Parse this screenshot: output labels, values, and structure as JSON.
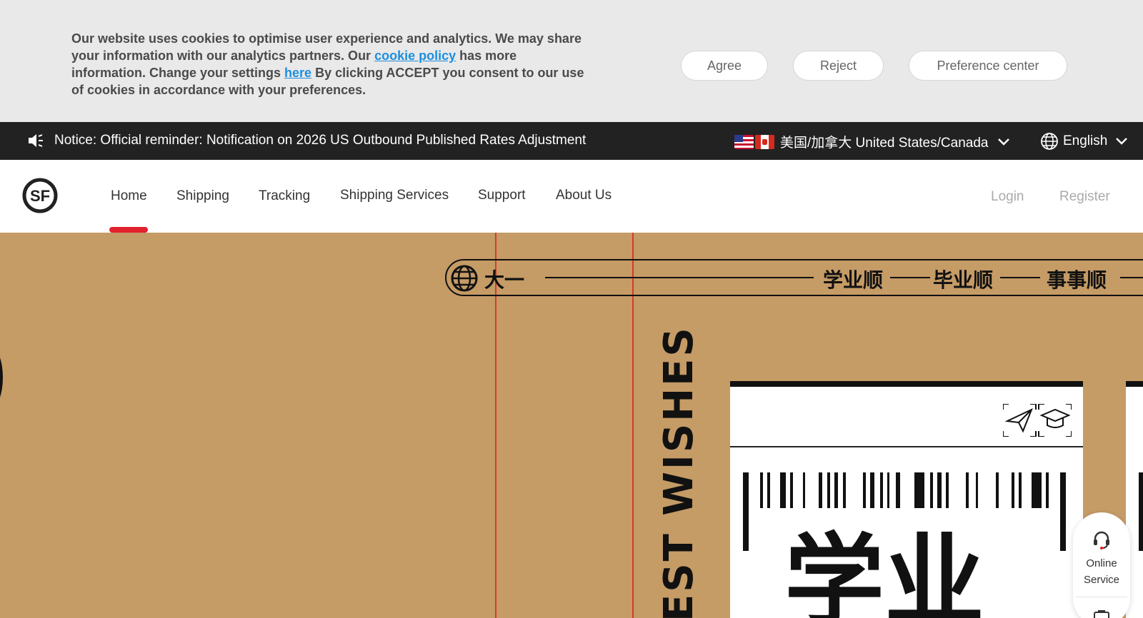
{
  "cookie_banner": {
    "text_part1": "Our website uses cookies to optimise user experience and analytics. We may share your information with our analytics partners. Our ",
    "cookie_policy_link": "cookie policy",
    "text_part2": " has more information. Change your settings ",
    "here_link": "here",
    "text_part3": " By clicking ACCEPT you consent to our use of cookies in accordance with your preferences.",
    "agree_label": "Agree",
    "reject_label": "Reject",
    "preference_label": "Preference center"
  },
  "notice_bar": {
    "notice_label": "Notice:",
    "notice_text": "Official reminder: Notification on 2026 US Outbound Published Rates Adjustment",
    "region_label": "美国/加拿大 United States/Canada",
    "language_label": "English"
  },
  "header": {
    "logo_text": "SF",
    "nav": [
      "Home",
      "Shipping",
      "Tracking",
      "Shipping Services",
      "Support",
      "About Us"
    ],
    "active_nav": "Home",
    "login_label": "Login",
    "register_label": "Register"
  },
  "hero": {
    "tag_text": "大一",
    "wish_1": "学业顺",
    "wish_2": "毕业顺",
    "wish_3": "事事顺",
    "vertical_text": "EST WISHES",
    "big_text": "学业"
  },
  "floating_service": {
    "label_line1": "Online",
    "label_line2": "Service"
  },
  "colors": {
    "accent_red": "#e3202e",
    "hero_background": "#c59b66",
    "notice_bar_background": "#222222",
    "link_blue": "#1d8fe0"
  }
}
